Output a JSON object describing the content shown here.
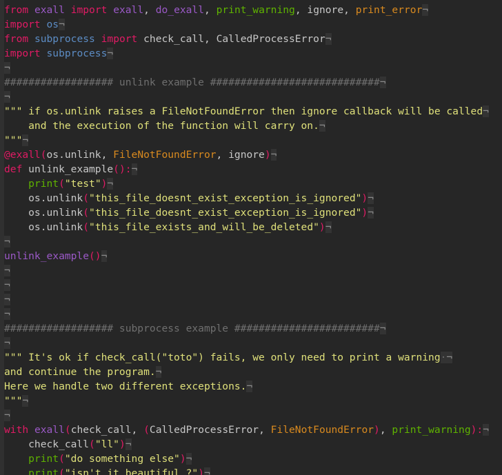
{
  "editor": {
    "name": "code-editor",
    "language": "python",
    "background_color": "#262626",
    "gutter_color": "#303030",
    "eol_glyph": "¬",
    "space_glyph": "·",
    "colors": {
      "keyword": "#e01b64",
      "module": "#5c8cc4",
      "violet": "#9b59c7",
      "green": "#5fb300",
      "plain": "#c8c8c8",
      "orange": "#d98a1f",
      "string": "#dfe07a",
      "comment": "#6f6f6f",
      "eol_marker": "#8a8a8a"
    }
  },
  "lines": [
    {
      "n": 1,
      "tokens": [
        {
          "t": "from",
          "c": "kw"
        },
        {
          "t": " ",
          "c": "pln"
        },
        {
          "t": "exall",
          "c": "viol"
        },
        {
          "t": " ",
          "c": "pln"
        },
        {
          "t": "import",
          "c": "kw"
        },
        {
          "t": " ",
          "c": "pln"
        },
        {
          "t": "exall",
          "c": "viol"
        },
        {
          "t": ", ",
          "c": "pln"
        },
        {
          "t": "do_exall",
          "c": "viol"
        },
        {
          "t": ", ",
          "c": "pln"
        },
        {
          "t": "print_warning",
          "c": "grn"
        },
        {
          "t": ", ",
          "c": "pln"
        },
        {
          "t": "ignore",
          "c": "pln"
        },
        {
          "t": ", ",
          "c": "pln"
        },
        {
          "t": "print_error",
          "c": "org"
        }
      ],
      "eol": true
    },
    {
      "n": 2,
      "tokens": [
        {
          "t": "import",
          "c": "kw"
        },
        {
          "t": " ",
          "c": "pln"
        },
        {
          "t": "os",
          "c": "mod"
        }
      ],
      "eol": true
    },
    {
      "n": 3,
      "tokens": [
        {
          "t": "from",
          "c": "kw"
        },
        {
          "t": " ",
          "c": "pln"
        },
        {
          "t": "subprocess",
          "c": "mod"
        },
        {
          "t": " ",
          "c": "pln"
        },
        {
          "t": "import",
          "c": "kw"
        },
        {
          "t": " ",
          "c": "pln"
        },
        {
          "t": "check_call, CalledProcessError",
          "c": "pln"
        }
      ],
      "eol": true
    },
    {
      "n": 4,
      "tokens": [
        {
          "t": "import",
          "c": "kw"
        },
        {
          "t": " ",
          "c": "pln"
        },
        {
          "t": "subprocess",
          "c": "mod"
        }
      ],
      "eol": true
    },
    {
      "n": 5,
      "tokens": [],
      "eol": true
    },
    {
      "n": 6,
      "tokens": [
        {
          "t": "################## unlink example ############################",
          "c": "cmt"
        }
      ],
      "eol": true
    },
    {
      "n": 7,
      "tokens": [],
      "eol": true
    },
    {
      "n": 8,
      "tokens": [
        {
          "t": "\"\"\" if os.unlink raises a FileNotFoundError then ignore callback will be called",
          "c": "str"
        }
      ],
      "eol": true
    },
    {
      "n": 9,
      "tokens": [
        {
          "t": "    and the execution of the function will carry on.",
          "c": "str"
        }
      ],
      "eol": true
    },
    {
      "n": 10,
      "tokens": [
        {
          "t": "\"\"\"",
          "c": "str"
        }
      ],
      "eol": true
    },
    {
      "n": 11,
      "tokens": [
        {
          "t": "@exall",
          "c": "kw"
        },
        {
          "t": "(",
          "c": "par"
        },
        {
          "t": "os.unlink, ",
          "c": "pln"
        },
        {
          "t": "FileNotFoundError",
          "c": "org"
        },
        {
          "t": ", ",
          "c": "pln"
        },
        {
          "t": "ignore",
          "c": "pln"
        },
        {
          "t": ")",
          "c": "par"
        }
      ],
      "eol": true
    },
    {
      "n": 12,
      "tokens": [
        {
          "t": "def",
          "c": "kw"
        },
        {
          "t": " ",
          "c": "pln"
        },
        {
          "t": "unlink_example",
          "c": "pln"
        },
        {
          "t": "():",
          "c": "par"
        }
      ],
      "eol": true
    },
    {
      "n": 13,
      "tokens": [
        {
          "t": "    ",
          "c": "pln"
        },
        {
          "t": "print",
          "c": "grn"
        },
        {
          "t": "(",
          "c": "par"
        },
        {
          "t": "\"test\"",
          "c": "str"
        },
        {
          "t": ")",
          "c": "par"
        }
      ],
      "eol": true
    },
    {
      "n": 14,
      "tokens": [
        {
          "t": "    os.unlink",
          "c": "pln"
        },
        {
          "t": "(",
          "c": "par"
        },
        {
          "t": "\"this_file_doesnt_exist_exception_is_ignored\"",
          "c": "str"
        },
        {
          "t": ")",
          "c": "par"
        }
      ],
      "eol": true
    },
    {
      "n": 15,
      "tokens": [
        {
          "t": "    os.unlink",
          "c": "pln"
        },
        {
          "t": "(",
          "c": "par"
        },
        {
          "t": "\"this_file_doesnt_exist_exception_is_ignored\"",
          "c": "str"
        },
        {
          "t": ")",
          "c": "par"
        }
      ],
      "eol": true
    },
    {
      "n": 16,
      "tokens": [
        {
          "t": "    os.unlink",
          "c": "pln"
        },
        {
          "t": "(",
          "c": "par"
        },
        {
          "t": "\"this_file_exists_and_will_be_deleted\"",
          "c": "str"
        },
        {
          "t": ")",
          "c": "par"
        }
      ],
      "eol": true
    },
    {
      "n": 17,
      "tokens": [],
      "eol": true
    },
    {
      "n": 18,
      "tokens": [
        {
          "t": "unlink_example",
          "c": "viol"
        },
        {
          "t": "()",
          "c": "par"
        }
      ],
      "eol": true
    },
    {
      "n": 19,
      "tokens": [],
      "eol": true
    },
    {
      "n": 20,
      "tokens": [],
      "eol": true
    },
    {
      "n": 21,
      "tokens": [],
      "eol": true
    },
    {
      "n": 22,
      "tokens": [],
      "eol": true
    },
    {
      "n": 23,
      "tokens": [
        {
          "t": "################## subprocess example ########################",
          "c": "cmt"
        }
      ],
      "eol": true
    },
    {
      "n": 24,
      "tokens": [],
      "eol": true
    },
    {
      "n": 25,
      "tokens": [
        {
          "t": "\"\"\" It's ok if check_call(\"toto\") fails, we only need to print a warning",
          "c": "str"
        }
      ],
      "eol": true,
      "trailing_space": true
    },
    {
      "n": 26,
      "tokens": [
        {
          "t": "and continue the program.",
          "c": "str"
        }
      ],
      "eol": true
    },
    {
      "n": 27,
      "tokens": [
        {
          "t": "Here we handle two different exceptions.",
          "c": "str"
        }
      ],
      "eol": true
    },
    {
      "n": 28,
      "tokens": [
        {
          "t": "\"\"\"",
          "c": "str"
        }
      ],
      "eol": true
    },
    {
      "n": 29,
      "tokens": [],
      "eol": true
    },
    {
      "n": 30,
      "tokens": [
        {
          "t": "with",
          "c": "kw"
        },
        {
          "t": " ",
          "c": "pln"
        },
        {
          "t": "exall",
          "c": "viol"
        },
        {
          "t": "(",
          "c": "par"
        },
        {
          "t": "check_call, ",
          "c": "pln"
        },
        {
          "t": "(",
          "c": "par"
        },
        {
          "t": "CalledProcessError",
          "c": "pln"
        },
        {
          "t": ", ",
          "c": "pln"
        },
        {
          "t": "FileNotFoundError",
          "c": "org"
        },
        {
          "t": ")",
          "c": "par"
        },
        {
          "t": ", ",
          "c": "pln"
        },
        {
          "t": "print_warning",
          "c": "grn"
        },
        {
          "t": "):",
          "c": "par"
        }
      ],
      "eol": true
    },
    {
      "n": 31,
      "tokens": [
        {
          "t": "    check_call",
          "c": "pln"
        },
        {
          "t": "(",
          "c": "par"
        },
        {
          "t": "\"ll\"",
          "c": "str"
        },
        {
          "t": ")",
          "c": "par"
        }
      ],
      "eol": true
    },
    {
      "n": 32,
      "tokens": [
        {
          "t": "    ",
          "c": "pln"
        },
        {
          "t": "print",
          "c": "grn"
        },
        {
          "t": "(",
          "c": "par"
        },
        {
          "t": "\"do something else\"",
          "c": "str"
        },
        {
          "t": ")",
          "c": "par"
        }
      ],
      "eol": true
    },
    {
      "n": 33,
      "tokens": [
        {
          "t": "    ",
          "c": "pln"
        },
        {
          "t": "print",
          "c": "grn"
        },
        {
          "t": "(",
          "c": "par"
        },
        {
          "t": "\"isn't it beautiful ?\"",
          "c": "str"
        },
        {
          "t": ")",
          "c": "par"
        }
      ],
      "eol": true
    }
  ]
}
